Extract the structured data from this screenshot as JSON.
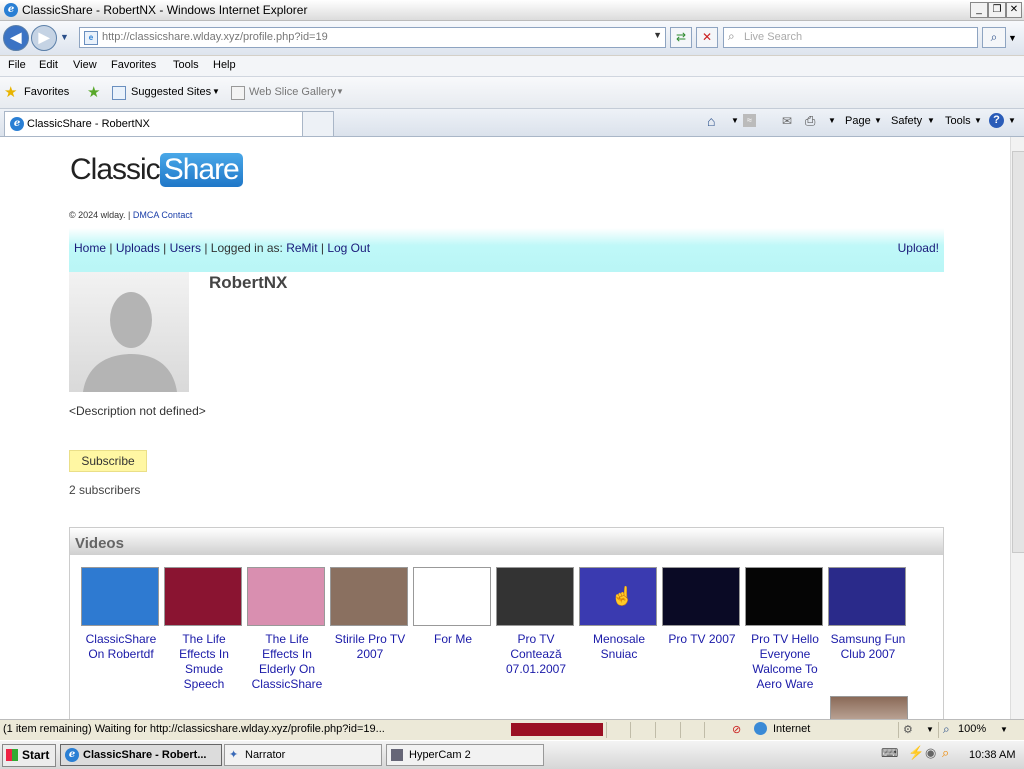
{
  "window": {
    "title": "ClassicShare - RobertNX - Windows Internet Explorer"
  },
  "browser": {
    "url": "http://classicshare.wlday.xyz/profile.php?id=19",
    "search_placeholder": "Live Search",
    "menu": [
      "File",
      "Edit",
      "View",
      "Favorites",
      "Tools",
      "Help"
    ],
    "favorites_label": "Favorites",
    "favorites_items": [
      "Suggested Sites",
      "Web Slice Gallery"
    ],
    "tab_title": "ClassicShare - RobertNX",
    "tools": {
      "page": "Page",
      "safety": "Safety",
      "tools": "Tools"
    }
  },
  "page": {
    "logo": {
      "part1": "Classic",
      "part2": "Share"
    },
    "footer_copy": "© 2024 wlday. |",
    "footer_link": "DMCA Contact",
    "nav": {
      "home": "Home",
      "uploads": "Uploads",
      "users": "Users",
      "logged_in_prefix": "Logged in as:",
      "user": "ReMit",
      "logout": "Log Out",
      "upload": "Upload!"
    },
    "profile": {
      "name": "RobertNX",
      "description": "<Description not defined>",
      "subscribe": "Subscribe",
      "subscribers": "2 subscribers"
    },
    "videos_header": "Videos",
    "videos": [
      {
        "title": "ClassicShare On Robertdf",
        "thumb": "#2e7ad1"
      },
      {
        "title": "The Life Effects In Smude Speech",
        "thumb": "#8a1431"
      },
      {
        "title": "The Life Effects In Elderly On ClassicShare",
        "thumb": "#d98fb0"
      },
      {
        "title": "Stirile Pro TV 2007",
        "thumb": "#8a7060"
      },
      {
        "title": "For Me",
        "thumb": "#ffffff"
      },
      {
        "title": "Pro TV Contează 07.01.2007",
        "thumb": "#333333"
      },
      {
        "title": "Menosale Snuiac",
        "thumb": "#3a3ab0"
      },
      {
        "title": "Pro TV 2007",
        "thumb": "#0a0a25"
      },
      {
        "title": "Pro TV Hello Everyone Walcome To Aero Ware",
        "thumb": "#050505"
      },
      {
        "title": "Samsung Fun Club 2007",
        "thumb": "#2a2a8a"
      }
    ]
  },
  "statusbar": {
    "message": "(1 item remaining) Waiting for http://classicshare.wlday.xyz/profile.php?id=19...",
    "zone": "Internet",
    "zoom": "100%"
  },
  "taskbar": {
    "start": "Start",
    "tasks": [
      "ClassicShare - Robert...",
      "Narrator",
      "HyperCam 2"
    ],
    "clock": "10:38 AM"
  }
}
